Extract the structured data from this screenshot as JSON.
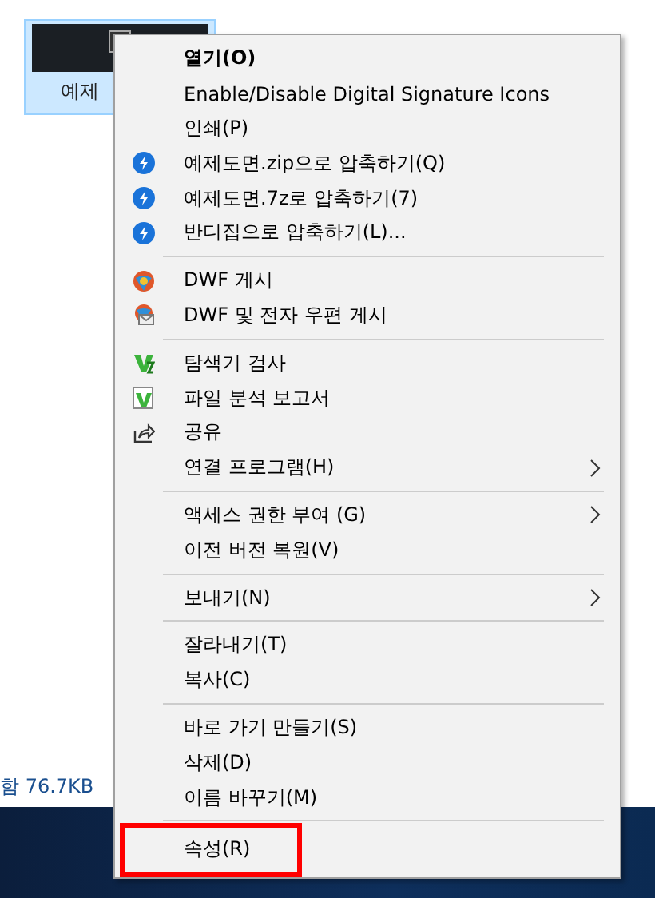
{
  "desktop_file": {
    "label": "예제",
    "selected": true
  },
  "status_bar": {
    "text": "함 76.7KB"
  },
  "context_menu": {
    "groups": [
      {
        "items": [
          {
            "label": "열기(O)",
            "default": true,
            "submenu": false,
            "annotated": false
          },
          {
            "label": "Enable/Disable Digital Signature Icons",
            "default": false,
            "submenu": false,
            "annotated": false
          },
          {
            "label": "인쇄(P)",
            "default": false,
            "submenu": false,
            "annotated": false
          },
          {
            "label": "예제도면.zip으로 압축하기(Q)",
            "kind": "bandizip",
            "default": false,
            "submenu": false,
            "annotated": false
          },
          {
            "label": "예제도면.7z로 압축하기(7)",
            "kind": "bandizip",
            "default": false,
            "submenu": false,
            "annotated": false
          },
          {
            "label": "반디집으로 압축하기(L)...",
            "kind": "bandizip",
            "default": false,
            "submenu": false,
            "annotated": false
          }
        ]
      },
      {
        "items": [
          {
            "label": "DWF 게시",
            "kind": "dwf",
            "default": false,
            "submenu": false,
            "annotated": false
          },
          {
            "label": "DWF 및 전자 우편 게시",
            "kind": "dwf-mail",
            "default": false,
            "submenu": false,
            "annotated": false
          }
        ]
      },
      {
        "items": [
          {
            "label": "탐색기 검사",
            "kind": "scan",
            "default": false,
            "submenu": false,
            "annotated": false
          },
          {
            "label": "파일 분석 보고서",
            "kind": "report",
            "default": false,
            "submenu": false,
            "annotated": false
          },
          {
            "label": "공유",
            "kind": "share",
            "default": false,
            "submenu": false,
            "annotated": false
          },
          {
            "label": "연결 프로그램(H)",
            "default": false,
            "submenu": true,
            "annotated": false
          }
        ]
      },
      {
        "items": [
          {
            "label": "액세스 권한 부여 (G)",
            "default": false,
            "submenu": true,
            "annotated": false
          },
          {
            "label": "이전 버전 복원(V)",
            "default": false,
            "submenu": false,
            "annotated": false
          }
        ]
      },
      {
        "items": [
          {
            "label": "보내기(N)",
            "default": false,
            "submenu": true,
            "annotated": false
          }
        ]
      },
      {
        "items": [
          {
            "label": "잘라내기(T)",
            "default": false,
            "submenu": false,
            "annotated": false
          },
          {
            "label": "복사(C)",
            "default": false,
            "submenu": false,
            "annotated": false
          }
        ]
      },
      {
        "items": [
          {
            "label": "바로 가기 만들기(S)",
            "default": false,
            "submenu": false,
            "annotated": false
          },
          {
            "label": "삭제(D)",
            "default": false,
            "submenu": false,
            "annotated": false
          },
          {
            "label": "이름 바꾸기(M)",
            "default": false,
            "submenu": false,
            "annotated": false
          }
        ]
      },
      {
        "items": [
          {
            "label": "속성(R)",
            "default": false,
            "submenu": false,
            "annotated": true
          }
        ]
      }
    ]
  }
}
